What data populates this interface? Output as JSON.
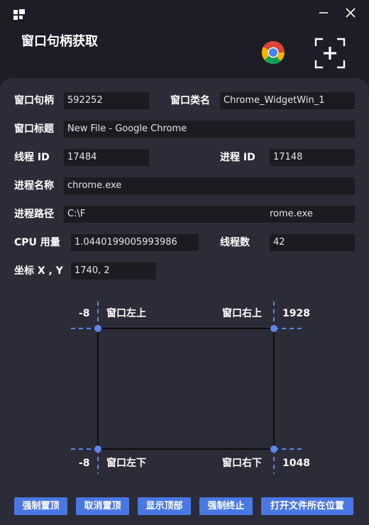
{
  "app": {
    "title": "窗口句柄获取",
    "icons": {
      "logo": "app-logo-icon",
      "minimize": "minimize-icon",
      "close": "close-icon",
      "browser": "chrome-logo-icon",
      "capture": "crosshair-capture-icon"
    }
  },
  "fields": {
    "handle": {
      "label": "窗口句柄",
      "value": "592252"
    },
    "class_name": {
      "label": "窗口类名",
      "value": "Chrome_WidgetWin_1"
    },
    "window_title": {
      "label": "窗口标题",
      "value": "New File - Google Chrome"
    },
    "thread_id": {
      "label": "线程 ID",
      "value": "17484"
    },
    "process_id": {
      "label": "进程 ID",
      "value": "17148"
    },
    "process_name": {
      "label": "进程名称",
      "value": "chrome.exe"
    },
    "process_path": {
      "label": "进程路径",
      "value_start": "C:\\F",
      "value_end": "rome.exe"
    },
    "cpu_usage": {
      "label": "CPU 用量",
      "value": "1.0440199005993986"
    },
    "thread_count": {
      "label": "线程数",
      "value": "42"
    },
    "coords": {
      "label": "坐标 X , Y",
      "value": "1740,  2"
    }
  },
  "rect": {
    "left": "-8",
    "top_right_x": "1928",
    "bottom_left_x": "-8",
    "bottom_right_y": "1048",
    "top_left_label": "窗口左上",
    "top_right_label": "窗口右上",
    "bottom_left_label": "窗口左下",
    "bottom_right_label": "窗口右下"
  },
  "buttons": {
    "force_top": "强制置顶",
    "cancel_top": "取消置顶",
    "show_top": "显示顶部",
    "force_kill": "强制终止",
    "open_location": "打开文件所在位置"
  },
  "colors": {
    "accent": "#4a78e3",
    "dash": "#5b86e8",
    "background": "#1d1d27",
    "panel": "#2c2c38",
    "field": "#1b1b22"
  }
}
